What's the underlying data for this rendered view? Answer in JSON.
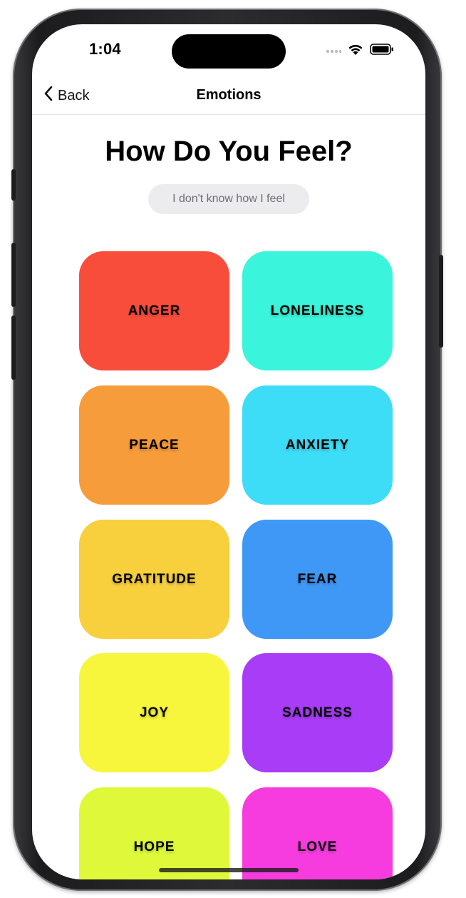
{
  "status": {
    "time": "1:04"
  },
  "nav": {
    "back_label": "Back",
    "title": "Emotions"
  },
  "page": {
    "heading": "How Do You Feel?",
    "unknown_button_label": "I don't know how I feel"
  },
  "emotions": [
    {
      "label": "ANGER",
      "color": "#f94d3c"
    },
    {
      "label": "LONELINESS",
      "color": "#3af5db"
    },
    {
      "label": "PEACE",
      "color": "#f69c3a"
    },
    {
      "label": "ANXIETY",
      "color": "#3ddcf7"
    },
    {
      "label": "GRATITUDE",
      "color": "#f8d03e"
    },
    {
      "label": "FEAR",
      "color": "#3f98f6"
    },
    {
      "label": "JOY",
      "color": "#f7f53c"
    },
    {
      "label": "SADNESS",
      "color": "#a93cf7"
    },
    {
      "label": "HOPE",
      "color": "#dff93a"
    },
    {
      "label": "LOVE",
      "color": "#f73cdf"
    }
  ]
}
